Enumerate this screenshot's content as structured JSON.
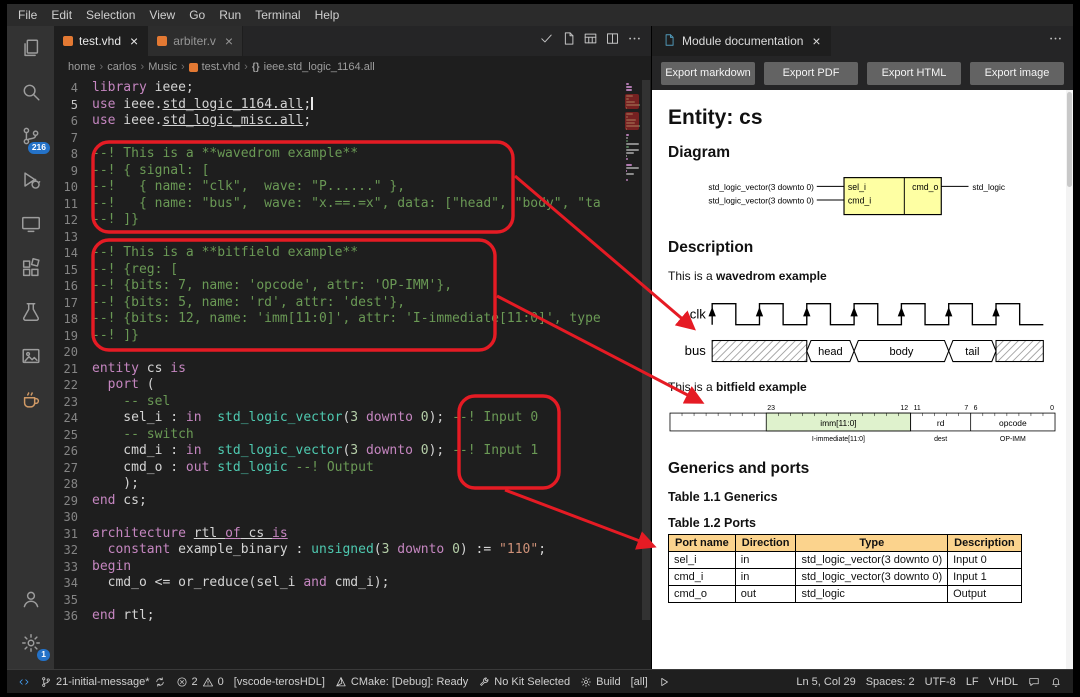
{
  "colors": {
    "annotation_red": "#e51b24",
    "badge_blue": "#2472c8",
    "entity_box_yellow": "#feffa3",
    "wavedrom_label_blue": "#0041c4",
    "bitfield_field_green": "#dff2cd",
    "table_header_bg": "#fbd38d",
    "keyword": "#c586c0",
    "type_color": "#4ec9b0",
    "comment": "#6a9955",
    "string_color": "#ce9178",
    "number": "#b5cea8"
  },
  "menubar": {
    "items": [
      "File",
      "Edit",
      "Selection",
      "View",
      "Go",
      "Run",
      "Terminal",
      "Help"
    ]
  },
  "activity_bar": {
    "top": [
      {
        "name": "explorer",
        "icon": "files"
      },
      {
        "name": "search",
        "icon": "search"
      },
      {
        "name": "source-control",
        "icon": "source-control",
        "badge": "216"
      },
      {
        "name": "run-and-debug",
        "icon": "debug"
      },
      {
        "name": "remote-explorer",
        "icon": "remote"
      },
      {
        "name": "extensions",
        "icon": "extensions"
      },
      {
        "name": "testing",
        "icon": "beaker"
      },
      {
        "name": "image-tool",
        "icon": "image"
      },
      {
        "name": "coffee-tool",
        "icon": "coffee",
        "color": "#d19a66"
      }
    ],
    "bottom": [
      {
        "name": "accounts",
        "icon": "account"
      },
      {
        "name": "manage",
        "icon": "gear",
        "badge": "1"
      }
    ]
  },
  "editor": {
    "tabs": [
      {
        "label": "test.vhd",
        "active": true
      },
      {
        "label": "arbiter.v",
        "active": false
      }
    ],
    "tab_actions": [
      {
        "name": "syntax-check",
        "icon": "check"
      },
      {
        "name": "open-preview",
        "icon": "file"
      },
      {
        "name": "grid-view",
        "icon": "grid"
      },
      {
        "name": "split-editor",
        "icon": "split"
      },
      {
        "name": "more-actions",
        "icon": "more"
      }
    ],
    "breadcrumb": [
      {
        "label": "home"
      },
      {
        "label": "carlos"
      },
      {
        "label": "Music"
      },
      {
        "label": "test.vhd",
        "icon": "vhd"
      },
      {
        "label": "ieee.std_logic_1164.all",
        "icon": "braces"
      }
    ],
    "lines": [
      {
        "n": 4,
        "t": [
          [
            "kw",
            "library"
          ],
          [
            "pl",
            " ieee;"
          ]
        ]
      },
      {
        "n": 5,
        "active": true,
        "caret": true,
        "t": [
          [
            "kw",
            "use"
          ],
          [
            "pl",
            " ieee."
          ],
          [
            "ul",
            "std_logic_1164.all"
          ],
          [
            "pl",
            ";"
          ]
        ]
      },
      {
        "n": 6,
        "t": [
          [
            "kw",
            "use"
          ],
          [
            "pl",
            " ieee."
          ],
          [
            "ul",
            "std_logic_misc.all"
          ],
          [
            "pl",
            ";"
          ]
        ]
      },
      {
        "n": 7,
        "t": []
      },
      {
        "n": 8,
        "t": [
          [
            "cm",
            "--! This is a **wavedrom example**"
          ]
        ]
      },
      {
        "n": 9,
        "t": [
          [
            "cm",
            "--! { signal: ["
          ]
        ]
      },
      {
        "n": 10,
        "t": [
          [
            "cm",
            "--!   { name: \"clk\",  wave: \"P......\" },"
          ]
        ]
      },
      {
        "n": 11,
        "t": [
          [
            "cm",
            "--!   { name: \"bus\",  wave: \"x.==.=x\", data: [\"head\", \"body\", \"ta"
          ]
        ]
      },
      {
        "n": 12,
        "t": [
          [
            "cm",
            "--! ]}"
          ]
        ]
      },
      {
        "n": 13,
        "t": []
      },
      {
        "n": 14,
        "t": [
          [
            "cm",
            "--! This is a **bitfield example**"
          ]
        ]
      },
      {
        "n": 15,
        "t": [
          [
            "cm",
            "--! {reg: ["
          ]
        ]
      },
      {
        "n": 16,
        "t": [
          [
            "cm",
            "--! {bits: 7, name: 'opcode', attr: 'OP-IMM'},"
          ]
        ]
      },
      {
        "n": 17,
        "t": [
          [
            "cm",
            "--! {bits: 5, name: 'rd', attr: 'dest'},"
          ]
        ]
      },
      {
        "n": 18,
        "t": [
          [
            "cm",
            "--! {bits: 12, name: 'imm[11:0]', attr: 'I-immediate[11:0]', type"
          ]
        ]
      },
      {
        "n": 19,
        "t": [
          [
            "cm",
            "--! ]}"
          ]
        ]
      },
      {
        "n": 20,
        "t": []
      },
      {
        "n": 21,
        "t": [
          [
            "kw",
            "entity"
          ],
          [
            "pl",
            " cs "
          ],
          [
            "kw",
            "is"
          ]
        ]
      },
      {
        "n": 22,
        "t": [
          [
            "pl",
            "  "
          ],
          [
            "kw",
            "port"
          ],
          [
            "pl",
            " ("
          ]
        ]
      },
      {
        "n": 23,
        "t": [
          [
            "cm",
            "    -- sel"
          ]
        ]
      },
      {
        "n": 24,
        "t": [
          [
            "pl",
            "    sel_i : "
          ],
          [
            "kw",
            "in"
          ],
          [
            "pl",
            "  "
          ],
          [
            "type",
            "std_logic_vector"
          ],
          [
            "pl",
            "("
          ],
          [
            "num",
            "3"
          ],
          [
            "pl",
            " "
          ],
          [
            "kw",
            "downto"
          ],
          [
            "pl",
            " "
          ],
          [
            "num",
            "0"
          ],
          [
            "pl",
            "); "
          ],
          [
            "cm",
            "--! Input 0"
          ]
        ]
      },
      {
        "n": 25,
        "t": [
          [
            "cm",
            "    -- switch"
          ]
        ]
      },
      {
        "n": 26,
        "t": [
          [
            "pl",
            "    cmd_i : "
          ],
          [
            "kw",
            "in"
          ],
          [
            "pl",
            "  "
          ],
          [
            "type",
            "std_logic_vector"
          ],
          [
            "pl",
            "("
          ],
          [
            "num",
            "3"
          ],
          [
            "pl",
            " "
          ],
          [
            "kw",
            "downto"
          ],
          [
            "pl",
            " "
          ],
          [
            "num",
            "0"
          ],
          [
            "pl",
            "); "
          ],
          [
            "cm",
            "--! Input 1"
          ]
        ]
      },
      {
        "n": 27,
        "t": [
          [
            "pl",
            "    cmd_o : "
          ],
          [
            "kw",
            "out"
          ],
          [
            "pl",
            " "
          ],
          [
            "type",
            "std_logic"
          ],
          [
            "pl",
            " "
          ],
          [
            "cm",
            "--! Output"
          ]
        ]
      },
      {
        "n": 28,
        "t": [
          [
            "pl",
            "    );"
          ]
        ]
      },
      {
        "n": 29,
        "t": [
          [
            "kw",
            "end"
          ],
          [
            "pl",
            " cs;"
          ]
        ]
      },
      {
        "n": 30,
        "t": []
      },
      {
        "n": 31,
        "t": [
          [
            "kw",
            "architecture"
          ],
          [
            "pl",
            " "
          ],
          [
            "ul",
            "rtl "
          ],
          [
            "kw ul",
            "of"
          ],
          [
            "ul",
            " cs "
          ],
          [
            "kw ul",
            "is"
          ]
        ]
      },
      {
        "n": 32,
        "t": [
          [
            "pl",
            "  "
          ],
          [
            "kw",
            "constant"
          ],
          [
            "pl",
            " example_binary : "
          ],
          [
            "type",
            "unsigned"
          ],
          [
            "pl",
            "("
          ],
          [
            "num",
            "3"
          ],
          [
            "pl",
            " "
          ],
          [
            "kw",
            "downto"
          ],
          [
            "pl",
            " "
          ],
          [
            "num",
            "0"
          ],
          [
            "pl",
            ") := "
          ],
          [
            "str",
            "\"110\""
          ],
          [
            "pl",
            ";"
          ]
        ]
      },
      {
        "n": 33,
        "t": [
          [
            "kw",
            "begin"
          ]
        ]
      },
      {
        "n": 34,
        "t": [
          [
            "pl",
            "  cmd_o <= or_reduce(sel_i "
          ],
          [
            "kw",
            "and"
          ],
          [
            "pl",
            " cmd_i);"
          ]
        ]
      },
      {
        "n": 35,
        "t": []
      },
      {
        "n": 36,
        "t": [
          [
            "kw",
            "end"
          ],
          [
            "pl",
            " rtl;"
          ]
        ]
      }
    ]
  },
  "panel": {
    "tab_label": "Module documentation",
    "export_buttons": [
      "Export markdown",
      "Export PDF",
      "Export HTML",
      "Export image"
    ],
    "doc": {
      "title": "Entity: cs",
      "diagram_heading": "Diagram",
      "description_heading": "Description",
      "generics_ports_heading": "Generics and ports",
      "wavedrom_text": {
        "prefix": "This is a ",
        "bold": "wavedrom example"
      },
      "bitfield_text": {
        "prefix": "This is a ",
        "bold": "bitfield example"
      },
      "diagram": {
        "input_type": "std_logic_vector(3 downto 0)",
        "output_type": "std_logic",
        "inputs": [
          "sel_i",
          "cmd_i"
        ],
        "output": "cmd_o"
      },
      "wave": {
        "clk_label": "clk",
        "bus_label": "bus",
        "bus_data": [
          "head",
          "body",
          "tail"
        ]
      },
      "bitfield": {
        "ticks": [
          "23",
          "12",
          "11",
          "7",
          "6",
          "0"
        ],
        "fields": [
          {
            "name": "imm[11:0]",
            "attr": "I-immediate[11:0]"
          },
          {
            "name": "rd",
            "attr": "dest"
          },
          {
            "name": "opcode",
            "attr": "OP-IMM"
          }
        ]
      },
      "generics_caption": "Table 1.1 Generics",
      "ports_caption": "Table 1.2 Ports",
      "ports_table": {
        "headers": [
          "Port name",
          "Direction",
          "Type",
          "Description"
        ],
        "rows": [
          [
            "sel_i",
            "in",
            "std_logic_vector(3 downto 0)",
            "Input 0"
          ],
          [
            "cmd_i",
            "in",
            "std_logic_vector(3 downto 0)",
            "Input 1"
          ],
          [
            "cmd_o",
            "out",
            "std_logic",
            "Output"
          ]
        ]
      }
    }
  },
  "statusbar": {
    "left": [
      {
        "name": "remote-indicator",
        "accent": true,
        "parts": [
          {
            "icon": "remote-glyph"
          }
        ]
      },
      {
        "name": "git-branch",
        "parts": [
          {
            "icon": "branch"
          },
          {
            "text": "21-initial-message*"
          },
          {
            "icon": "sync"
          }
        ]
      },
      {
        "name": "problems",
        "parts": [
          {
            "icon": "error"
          },
          {
            "text": "2"
          },
          {
            "icon": "warning"
          },
          {
            "text": "0"
          }
        ]
      },
      {
        "name": "teroshdl-extension",
        "parts": [
          {
            "text": "[vscode-terosHDL]"
          }
        ]
      },
      {
        "name": "cmake-status",
        "parts": [
          {
            "icon": "cmake"
          },
          {
            "text": "CMake: [Debug]: Ready"
          }
        ]
      },
      {
        "name": "cmake-kit",
        "parts": [
          {
            "icon": "tools"
          },
          {
            "text": "No Kit Selected"
          }
        ]
      },
      {
        "name": "cmake-build",
        "parts": [
          {
            "icon": "gear"
          },
          {
            "text": "Build"
          }
        ]
      },
      {
        "name": "cmake-target",
        "parts": [
          {
            "text": "[all]"
          }
        ]
      },
      {
        "name": "cmake-launch",
        "parts": [
          {
            "icon": "play"
          }
        ]
      }
    ],
    "right": [
      {
        "name": "cursor-position",
        "parts": [
          {
            "text": "Ln 5, Col 29"
          }
        ]
      },
      {
        "name": "indentation",
        "parts": [
          {
            "text": "Spaces: 2"
          }
        ]
      },
      {
        "name": "encoding",
        "parts": [
          {
            "text": "UTF-8"
          }
        ]
      },
      {
        "name": "eol",
        "parts": [
          {
            "text": "LF"
          }
        ]
      },
      {
        "name": "language-mode",
        "parts": [
          {
            "text": "VHDL"
          }
        ]
      },
      {
        "name": "feedback",
        "parts": [
          {
            "icon": "feedback"
          }
        ]
      },
      {
        "name": "notifications",
        "parts": [
          {
            "icon": "bell"
          }
        ]
      }
    ]
  }
}
